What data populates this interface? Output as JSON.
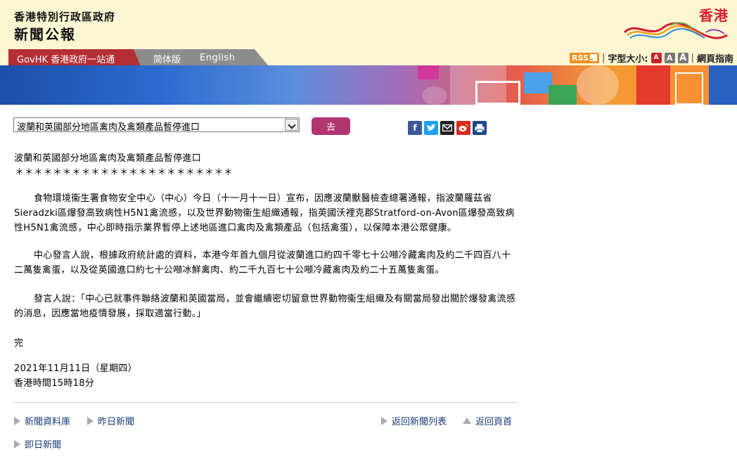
{
  "header": {
    "gov_name": "香港特別行政區政府",
    "title": "新聞公報",
    "logo_text": "香港"
  },
  "nav": {
    "govhk": "GovHK 香港政府一站通",
    "simplified": "简体版",
    "english": "English"
  },
  "tools": {
    "rss": "RSS",
    "font_size_label": "字型大小:",
    "font_sizes": [
      "A",
      "A",
      "A"
    ],
    "guide": "網頁指南"
  },
  "selector": {
    "selected": "波蘭和英國部分地區禽肉及禽類產品暫停進口",
    "go": "去"
  },
  "article": {
    "headline": "波蘭和英國部分地區禽肉及禽類產品暫停進口",
    "stars": "＊＊＊＊＊＊＊＊＊＊＊＊＊＊＊＊＊＊＊＊＊＊＊",
    "para1": "食物環境衞生署食物安全中心（中心）今日（十一月十一日）宣布，因應波蘭獸醫檢查總署通報，指波蘭羅茲省Sieradzki區爆發高致病性H5N1禽流感，以及世界動物衞生組織通報，指英國沃裡克郡Stratford-on-Avon區爆發高致病性H5N1禽流感，中心即時指示業界暫停上述地區進口禽肉及禽類產品（包括禽蛋），以保障本港公眾健康。",
    "para2": "中心發言人說，根據政府統計處的資料，本港今年首九個月從波蘭進口約四千零七十公噸冷藏禽肉及約二千四百八十二萬隻禽蛋，以及從英國進口約七十公噸冰鮮禽肉、約二千九百七十公噸冷藏禽肉及約二十五萬隻禽蛋。",
    "para3": "發言人說：「中心已就事件聯絡波蘭和英國當局，並會繼續密切留意世界動物衞生組織及有關當局發出關於爆發禽流感的消息，因應當地疫情發展，採取適當行動。」",
    "end": "完",
    "date": "2021年11月11日（星期四）",
    "time": "香港時間15時18分"
  },
  "footer": {
    "archive": "新聞資料庫",
    "yesterday": "昨日新聞",
    "back_list": "返回新聞列表",
    "back_top": "返回頁首",
    "today": "即日新聞"
  }
}
